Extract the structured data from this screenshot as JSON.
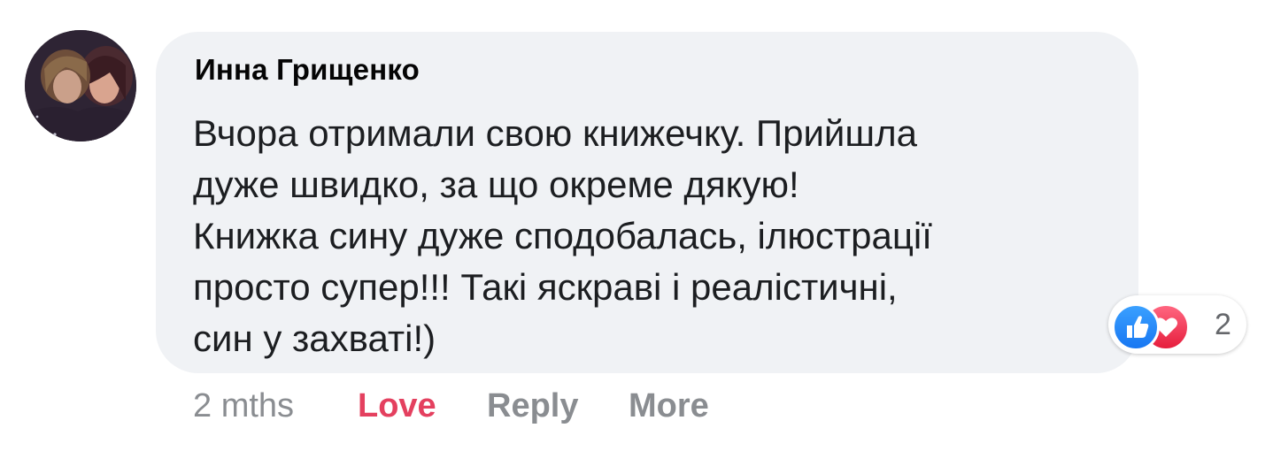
{
  "comment": {
    "author": "Инна Грищенко",
    "avatar_icon": "user-photo-avatar",
    "text_lines": [
      "Вчора отримали свою книжечку. Прийшла",
      "дуже швидко, за що окреме дякую!",
      "Книжка сину дуже сподобалась, ілюстрації",
      "просто супер!!! Такі яскраві і реалістичні,",
      "син у захваті!)"
    ],
    "reactions": {
      "icons": [
        "like-icon",
        "love-icon"
      ],
      "count": "2"
    },
    "actions": {
      "timestamp": "2 mths",
      "love": "Love",
      "reply": "Reply",
      "more": "More"
    }
  },
  "colors": {
    "bubble_bg": "#f0f2f5",
    "love_red": "#e4405f",
    "like_blue": "#1877f2",
    "muted_text": "#8a8d91"
  }
}
